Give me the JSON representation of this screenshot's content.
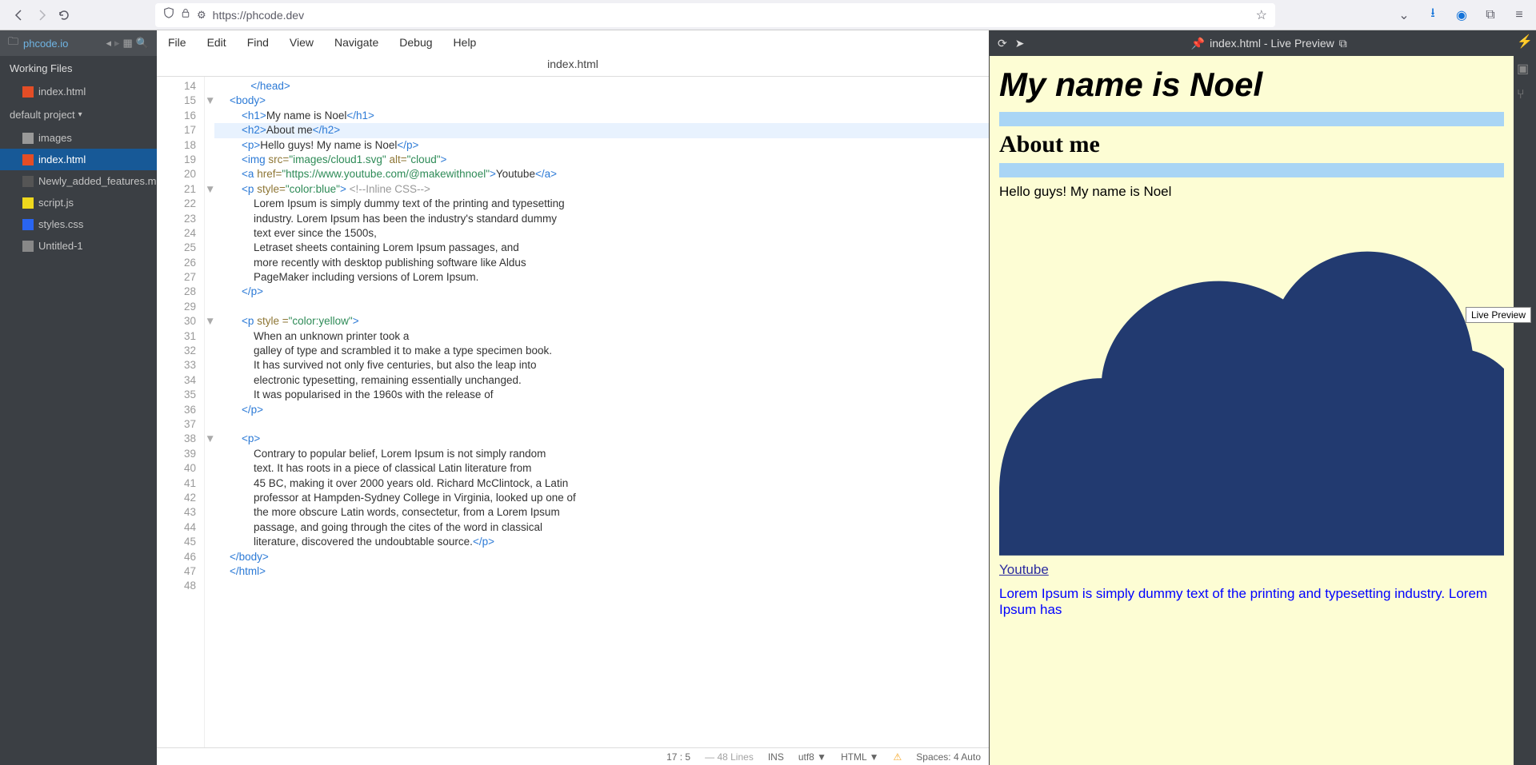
{
  "browser": {
    "url": "https://phcode.dev"
  },
  "sidebar": {
    "project_title": "phcode.io",
    "working_files": "Working Files",
    "working_items": [
      {
        "label": "index.html",
        "type": "html"
      }
    ],
    "project_label": "default project",
    "tree": [
      {
        "label": "images",
        "type": "folder"
      },
      {
        "label": "index.html",
        "type": "html",
        "sel": true
      },
      {
        "label": "Newly_added_features.m",
        "type": "md"
      },
      {
        "label": "script.js",
        "type": "js"
      },
      {
        "label": "styles.css",
        "type": "css"
      },
      {
        "label": "Untitled-1",
        "type": "txt"
      }
    ]
  },
  "menu": {
    "items": [
      "File",
      "Edit",
      "Find",
      "View",
      "Navigate",
      "Debug",
      "Help"
    ]
  },
  "tab_title": "index.html",
  "code_lines": [
    {
      "n": 14,
      "html": "           <span class='t'>&lt;/head&gt;</span>"
    },
    {
      "n": 15,
      "fold": "▼",
      "html": "    <span class='t'>&lt;body&gt;</span>"
    },
    {
      "n": 16,
      "html": "        <span class='t'>&lt;h1&gt;</span><span class='txt'>My name is Noel</span><span class='t'>&lt;/h1&gt;</span>"
    },
    {
      "n": 17,
      "hl": true,
      "html": "        <span class='t'>&lt;h2&gt;</span><span class='txt'>About me</span><span class='t'>&lt;/h2&gt;</span>"
    },
    {
      "n": 18,
      "html": "        <span class='t'>&lt;p&gt;</span><span class='txt'>Hello guys! My name is Noel</span><span class='t'>&lt;/p&gt;</span>"
    },
    {
      "n": 19,
      "html": "        <span class='t'>&lt;img</span> <span class='attr'>src=</span><span class='str'>\"images/cloud1.svg\"</span> <span class='attr'>alt=</span><span class='str'>\"cloud\"</span><span class='t'>&gt;</span>"
    },
    {
      "n": 20,
      "html": "        <span class='t'>&lt;a</span> <span class='attr'>href=</span><span class='str'>\"https://www.youtube.com/@makewithnoel\"</span><span class='t'>&gt;</span><span class='txt'>Youtube</span><span class='t'>&lt;/a&gt;</span>"
    },
    {
      "n": 21,
      "fold": "▼",
      "html": "        <span class='t'>&lt;p</span> <span class='attr'>style=</span><span class='str'>\"color:blue\"</span><span class='t'>&gt;</span> <span class='cmt'>&lt;!--Inline CSS--&gt;</span>"
    },
    {
      "n": 22,
      "html": "            <span class='txt'>Lorem Ipsum is simply dummy text of the printing and typesetting</span>"
    },
    {
      "n": 23,
      "html": "            <span class='txt'>industry. Lorem Ipsum has been the industry's standard dummy</span>"
    },
    {
      "n": 24,
      "html": "            <span class='txt'>text ever since the 1500s,</span>"
    },
    {
      "n": 25,
      "html": "            <span class='txt'>Letraset sheets containing Lorem Ipsum passages, and</span>"
    },
    {
      "n": 26,
      "html": "            <span class='txt'>more recently with desktop publishing software like Aldus</span>"
    },
    {
      "n": 27,
      "html": "            <span class='txt'>PageMaker including versions of Lorem Ipsum.</span>"
    },
    {
      "n": 28,
      "html": "        <span class='t'>&lt;/p&gt;</span>"
    },
    {
      "n": 29,
      "html": ""
    },
    {
      "n": 30,
      "fold": "▼",
      "html": "        <span class='t'>&lt;p</span> <span class='attr'>style =</span><span class='str'>\"color:yellow\"</span><span class='t'>&gt;</span>"
    },
    {
      "n": 31,
      "html": "            <span class='txt'>When an unknown printer took a</span>"
    },
    {
      "n": 32,
      "html": "            <span class='txt'>galley of type and scrambled it to make a type specimen book.</span>"
    },
    {
      "n": 33,
      "html": "            <span class='txt'>It has survived not only five centuries, but also the leap into</span>"
    },
    {
      "n": 34,
      "html": "            <span class='txt'>electronic typesetting, remaining essentially unchanged.</span>"
    },
    {
      "n": 35,
      "html": "            <span class='txt'>It was popularised in the 1960s with the release of</span>"
    },
    {
      "n": 36,
      "html": "        <span class='t'>&lt;/p&gt;</span>"
    },
    {
      "n": 37,
      "html": ""
    },
    {
      "n": 38,
      "fold": "▼",
      "html": "        <span class='t'>&lt;p&gt;</span>"
    },
    {
      "n": 39,
      "html": "            <span class='txt'>Contrary to popular belief, Lorem Ipsum is not simply random</span>"
    },
    {
      "n": 40,
      "html": "            <span class='txt'>text. It has roots in a piece of classical Latin literature from</span>"
    },
    {
      "n": 41,
      "html": "            <span class='txt'>45 BC, making it over 2000 years old. Richard McClintock, a Latin</span>"
    },
    {
      "n": 42,
      "html": "            <span class='txt'>professor at Hampden-Sydney College in Virginia, looked up one of</span>"
    },
    {
      "n": 43,
      "html": "            <span class='txt'>the more obscure Latin words, consectetur, from a Lorem Ipsum</span>"
    },
    {
      "n": 44,
      "html": "            <span class='txt'>passage, and going through the cites of the word in classical</span>"
    },
    {
      "n": 45,
      "html": "            <span class='txt'>literature, discovered the undoubtable source.</span><span class='t'>&lt;/p&gt;</span>"
    },
    {
      "n": 46,
      "html": "    <span class='t'>&lt;/body&gt;</span>"
    },
    {
      "n": 47,
      "html": "    <span class='t'>&lt;/html&gt;</span>"
    },
    {
      "n": 48,
      "html": ""
    }
  ],
  "status": {
    "cursor": "17 : 5",
    "lines": "— 48 Lines",
    "ins": "INS",
    "enc": "utf8 ▼",
    "lang": "HTML ▼",
    "spaces": "Spaces: 4  Auto"
  },
  "preview": {
    "bar_title": "index.html - Live Preview",
    "h1": "My name is Noel",
    "h2": "About me",
    "p1": "Hello guys! My name is Noel",
    "link": "Youtube",
    "blue": "Lorem Ipsum is simply dummy text of the printing and typesetting industry. Lorem Ipsum has"
  },
  "tooltip": "Live Preview"
}
